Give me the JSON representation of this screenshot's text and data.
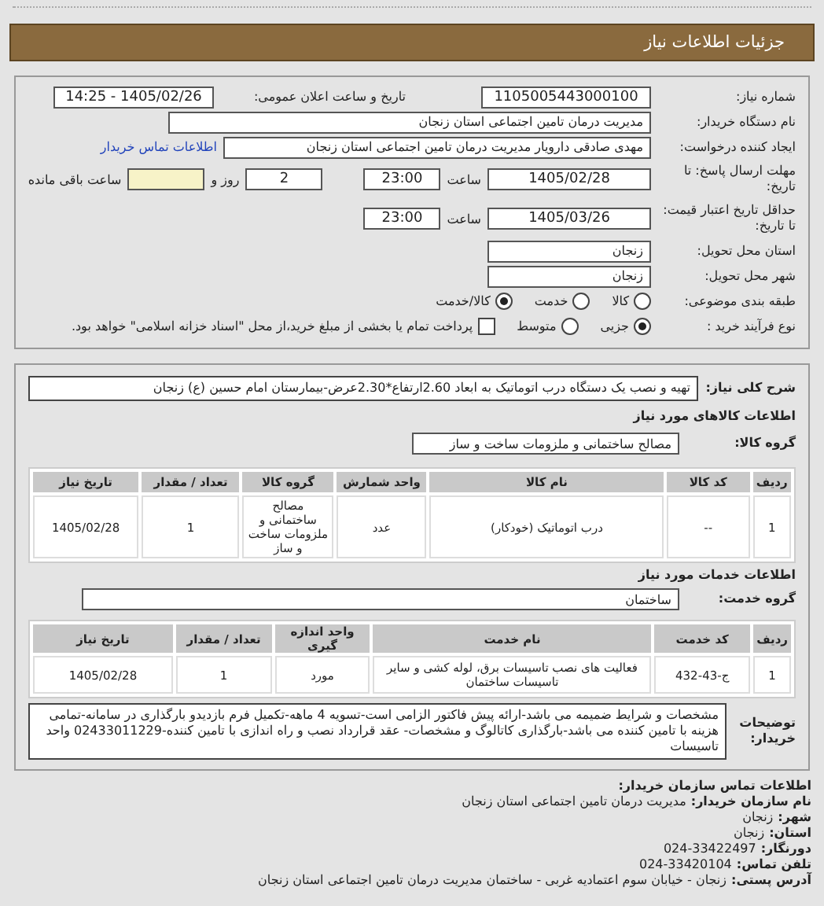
{
  "header": {
    "title": "جزئیات اطلاعات نیاز"
  },
  "need_number": {
    "label": "شماره نیاز:",
    "value": "1105005443000100"
  },
  "announce": {
    "label": "تاریخ و ساعت اعلان عمومی:",
    "value": "1405/02/26 - 14:25"
  },
  "buyer": {
    "label": "نام دستگاه خریدار:",
    "value": "مدیریت درمان تامین اجتماعی استان زنجان"
  },
  "requester": {
    "label": "ایجاد کننده درخواست:",
    "value": "مهدی صادقی دارویار مدیریت درمان تامین اجتماعی استان زنجان",
    "link": "اطلاعات تماس خریدار"
  },
  "deadline": {
    "label": "مهلت ارسال پاسخ: تا تاریخ:",
    "date": "1405/02/28",
    "time_label": "ساعت",
    "time": "23:00",
    "days": "2",
    "days_label": "روز و",
    "remaining_label": "ساعت باقی مانده"
  },
  "price_validity": {
    "label": "حداقل تاریخ اعتبار قیمت: تا تاریخ:",
    "date": "1405/03/26",
    "time_label": "ساعت",
    "time": "23:00"
  },
  "province": {
    "label": "استان محل تحویل:",
    "value": "زنجان"
  },
  "city": {
    "label": "شهر محل تحویل:",
    "value": "زنجان"
  },
  "category": {
    "label": "طبقه بندی موضوعی:",
    "options": [
      {
        "label": "کالا",
        "selected": false
      },
      {
        "label": "خدمت",
        "selected": false
      },
      {
        "label": "کالا/خدمت",
        "selected": true
      }
    ]
  },
  "process": {
    "label": "نوع فرآیند خرید :",
    "options": [
      {
        "label": "جزیی",
        "selected": true
      },
      {
        "label": "متوسط",
        "selected": false
      }
    ],
    "payment": {
      "checked": false,
      "label": "پرداخت تمام یا بخشی از مبلغ خرید،از محل \"اسناد خزانه اسلامی\" خواهد بود."
    }
  },
  "description": {
    "label": "شرح کلی نیاز:",
    "value": "تهیه و نصب یک دستگاه درب اتوماتیک به ابعاد 2.60ارتفاع*2.30عرض-بیمارستان امام حسین (ع) زنجان"
  },
  "goods_title": "اطلاعات کالاهای مورد نیاز",
  "goods_group": {
    "label": "گروه کالا:",
    "value": "مصالح ساختمانی و ملزومات ساخت و ساز"
  },
  "goods_table": {
    "columns": [
      "ردیف",
      "کد کالا",
      "نام کالا",
      "واحد شمارش",
      "گروه کالا",
      "تعداد / مقدار",
      "تاریخ نیاز"
    ],
    "rows": [
      [
        "1",
        "--",
        "درب اتوماتیک (خودکار)",
        "عدد",
        "مصالح ساختمانی و ملزومات ساخت و ساز",
        "1",
        "1405/02/28"
      ]
    ]
  },
  "services_title": "اطلاعات خدمات مورد نیاز",
  "service_group": {
    "label": "گروه خدمت:",
    "value": "ساختمان"
  },
  "services_table": {
    "columns": [
      "ردیف",
      "کد خدمت",
      "نام خدمت",
      "واحد اندازه گیری",
      "تعداد / مقدار",
      "تاریخ نیاز"
    ],
    "rows": [
      [
        "1",
        "ج-43-432",
        "فعالیت های نصب تاسیسات برق، لوله کشی و سایر تاسیسات ساختمان",
        "مورد",
        "1",
        "1405/02/28"
      ]
    ]
  },
  "buyer_notes": {
    "label": "توضیحات خریدار:",
    "value": "مشخصات و شرایط ضمیمه می باشد-ارائه پیش فاکتور الزامی است-تسویه 4 ماهه-تکمیل فرم بازدیدو بارگذاری در سامانه-تمامی هزینه با تامین کننده می باشد-بارگذاری کاتالوگ و مشخصات- عقد قرارداد نصب و راه اندازی با تامین کننده-02433011229 واحد تاسیسات"
  },
  "contact": {
    "title": "اطلاعات تماس سازمان خریدار:",
    "lines": [
      {
        "label": "نام سازمان خریدار:",
        "value": "مدیریت درمان تامین اجتماعی استان زنجان"
      },
      {
        "label": "شهر:",
        "value": "زنجان"
      },
      {
        "label": "استان:",
        "value": "زنجان"
      },
      {
        "label": "دورنگار:",
        "value": "024-33422497"
      },
      {
        "label": "تلفن تماس:",
        "value": "024-33420104"
      },
      {
        "label": "آدرس پستی:",
        "value": "زنجان - خیابان سوم اعتمادیه غربی - ساختمان مدیریت درمان تامین اجتماعی استان زنجان"
      }
    ]
  }
}
